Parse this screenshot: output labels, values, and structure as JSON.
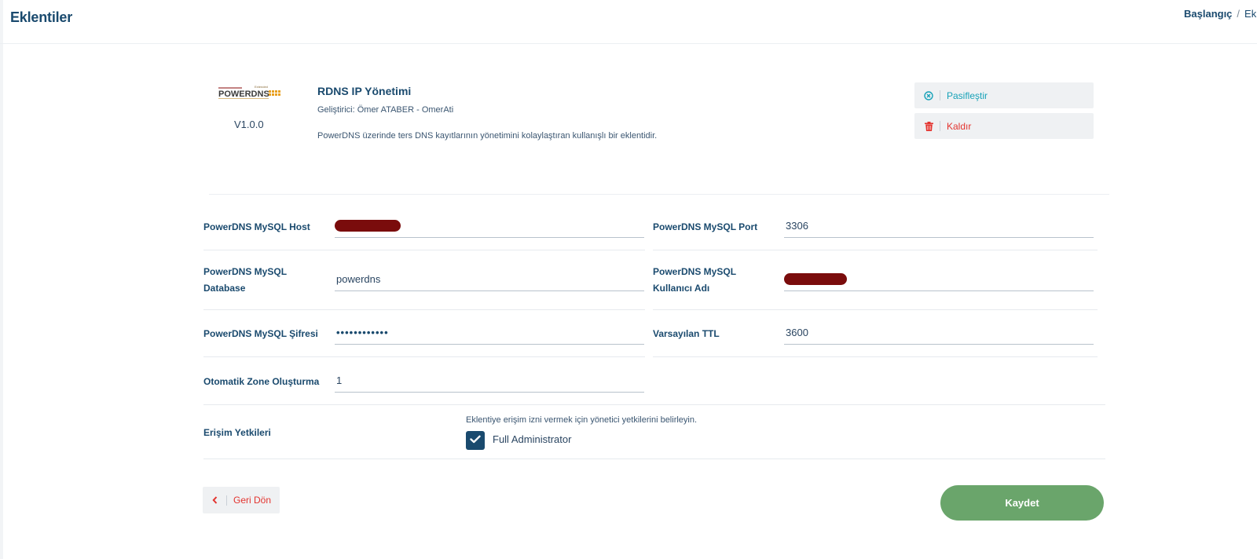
{
  "page": {
    "title": "Eklentiler",
    "breadcrumb": {
      "home": "Başlangıç",
      "separator": "/",
      "current": "Ek"
    }
  },
  "plugin": {
    "logo_alt": "POWERDNS",
    "version": "V1.0.0",
    "name": "RDNS IP Yönetimi",
    "developer": "Geliştirici: Ömer ATABER - OmerAti",
    "description": "PowerDNS üzerinde ters DNS kayıtlarının yönetimini kolaylaştıran kullanışlı bir eklentidir.",
    "actions": {
      "deactivate_label": "Pasifleştir",
      "deactivate_icon": "circle-x-icon",
      "remove_label": "Kaldır",
      "remove_icon": "trash-icon"
    }
  },
  "form": {
    "host": {
      "label": "PowerDNS MySQL Host",
      "value": "",
      "redacted": true
    },
    "port": {
      "label": "PowerDNS MySQL Port",
      "value": "3306"
    },
    "database": {
      "label_line1": "PowerDNS MySQL",
      "label_line2": "Database",
      "value": "powerdns"
    },
    "username": {
      "label_line1": "PowerDNS MySQL",
      "label_line2": "Kullanıcı Adı",
      "value": "",
      "redacted": true
    },
    "password": {
      "label": "PowerDNS MySQL Şifresi",
      "value": "••••••••••••"
    },
    "ttl": {
      "label": "Varsayılan TTL",
      "value": "3600"
    },
    "auto_zone": {
      "label": "Otomatik Zone Oluşturma",
      "value": "1"
    },
    "permissions": {
      "label": "Erişim Yetkileri",
      "hint": "Eklentiye erişim izni vermek için yönetici yetkilerini belirleyin.",
      "option_label": "Full Administrator",
      "checked": true
    }
  },
  "buttons": {
    "back_label": "Geri Dön",
    "save_label": "Kaydet"
  },
  "colors": {
    "primary": "#1a4a6e",
    "info": "#17a2b8",
    "danger": "#e3342f",
    "success": "#6aa56b",
    "redaction": "#7a0c0c"
  }
}
